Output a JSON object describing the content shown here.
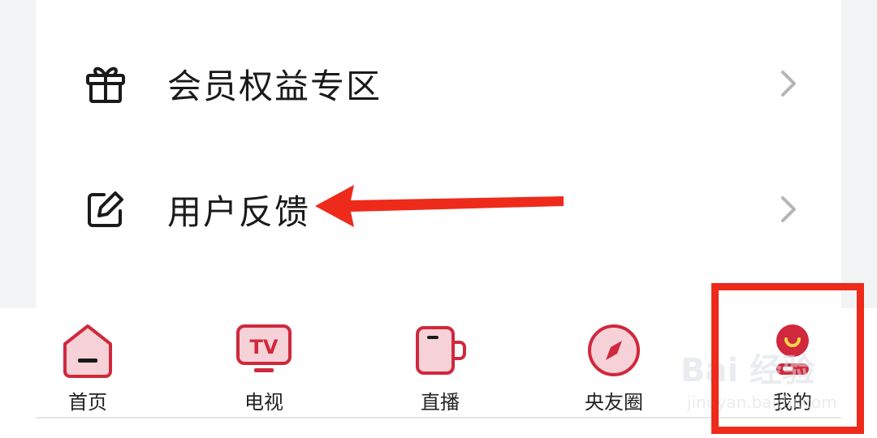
{
  "menu": {
    "items": [
      {
        "label": "会员权益专区",
        "icon": "gift-icon"
      },
      {
        "label": "用户反馈",
        "icon": "edit-icon"
      }
    ]
  },
  "tabbar": {
    "tabs": [
      {
        "label": "首页",
        "icon": "home-icon"
      },
      {
        "label": "电视",
        "icon": "tv-icon"
      },
      {
        "label": "直播",
        "icon": "live-cup-icon"
      },
      {
        "label": "央友圈",
        "icon": "compass-icon"
      },
      {
        "label": "我的",
        "icon": "profile-icon"
      }
    ]
  },
  "annotations": {
    "arrow_color": "#ee2a1b",
    "highlight_color": "#ee2a1b"
  },
  "watermark": {
    "main": "Bai 经验",
    "sub": "jingyan.baidu.com"
  },
  "colors": {
    "accent": "#d0283c",
    "accent_light": "#f3c1c8"
  }
}
